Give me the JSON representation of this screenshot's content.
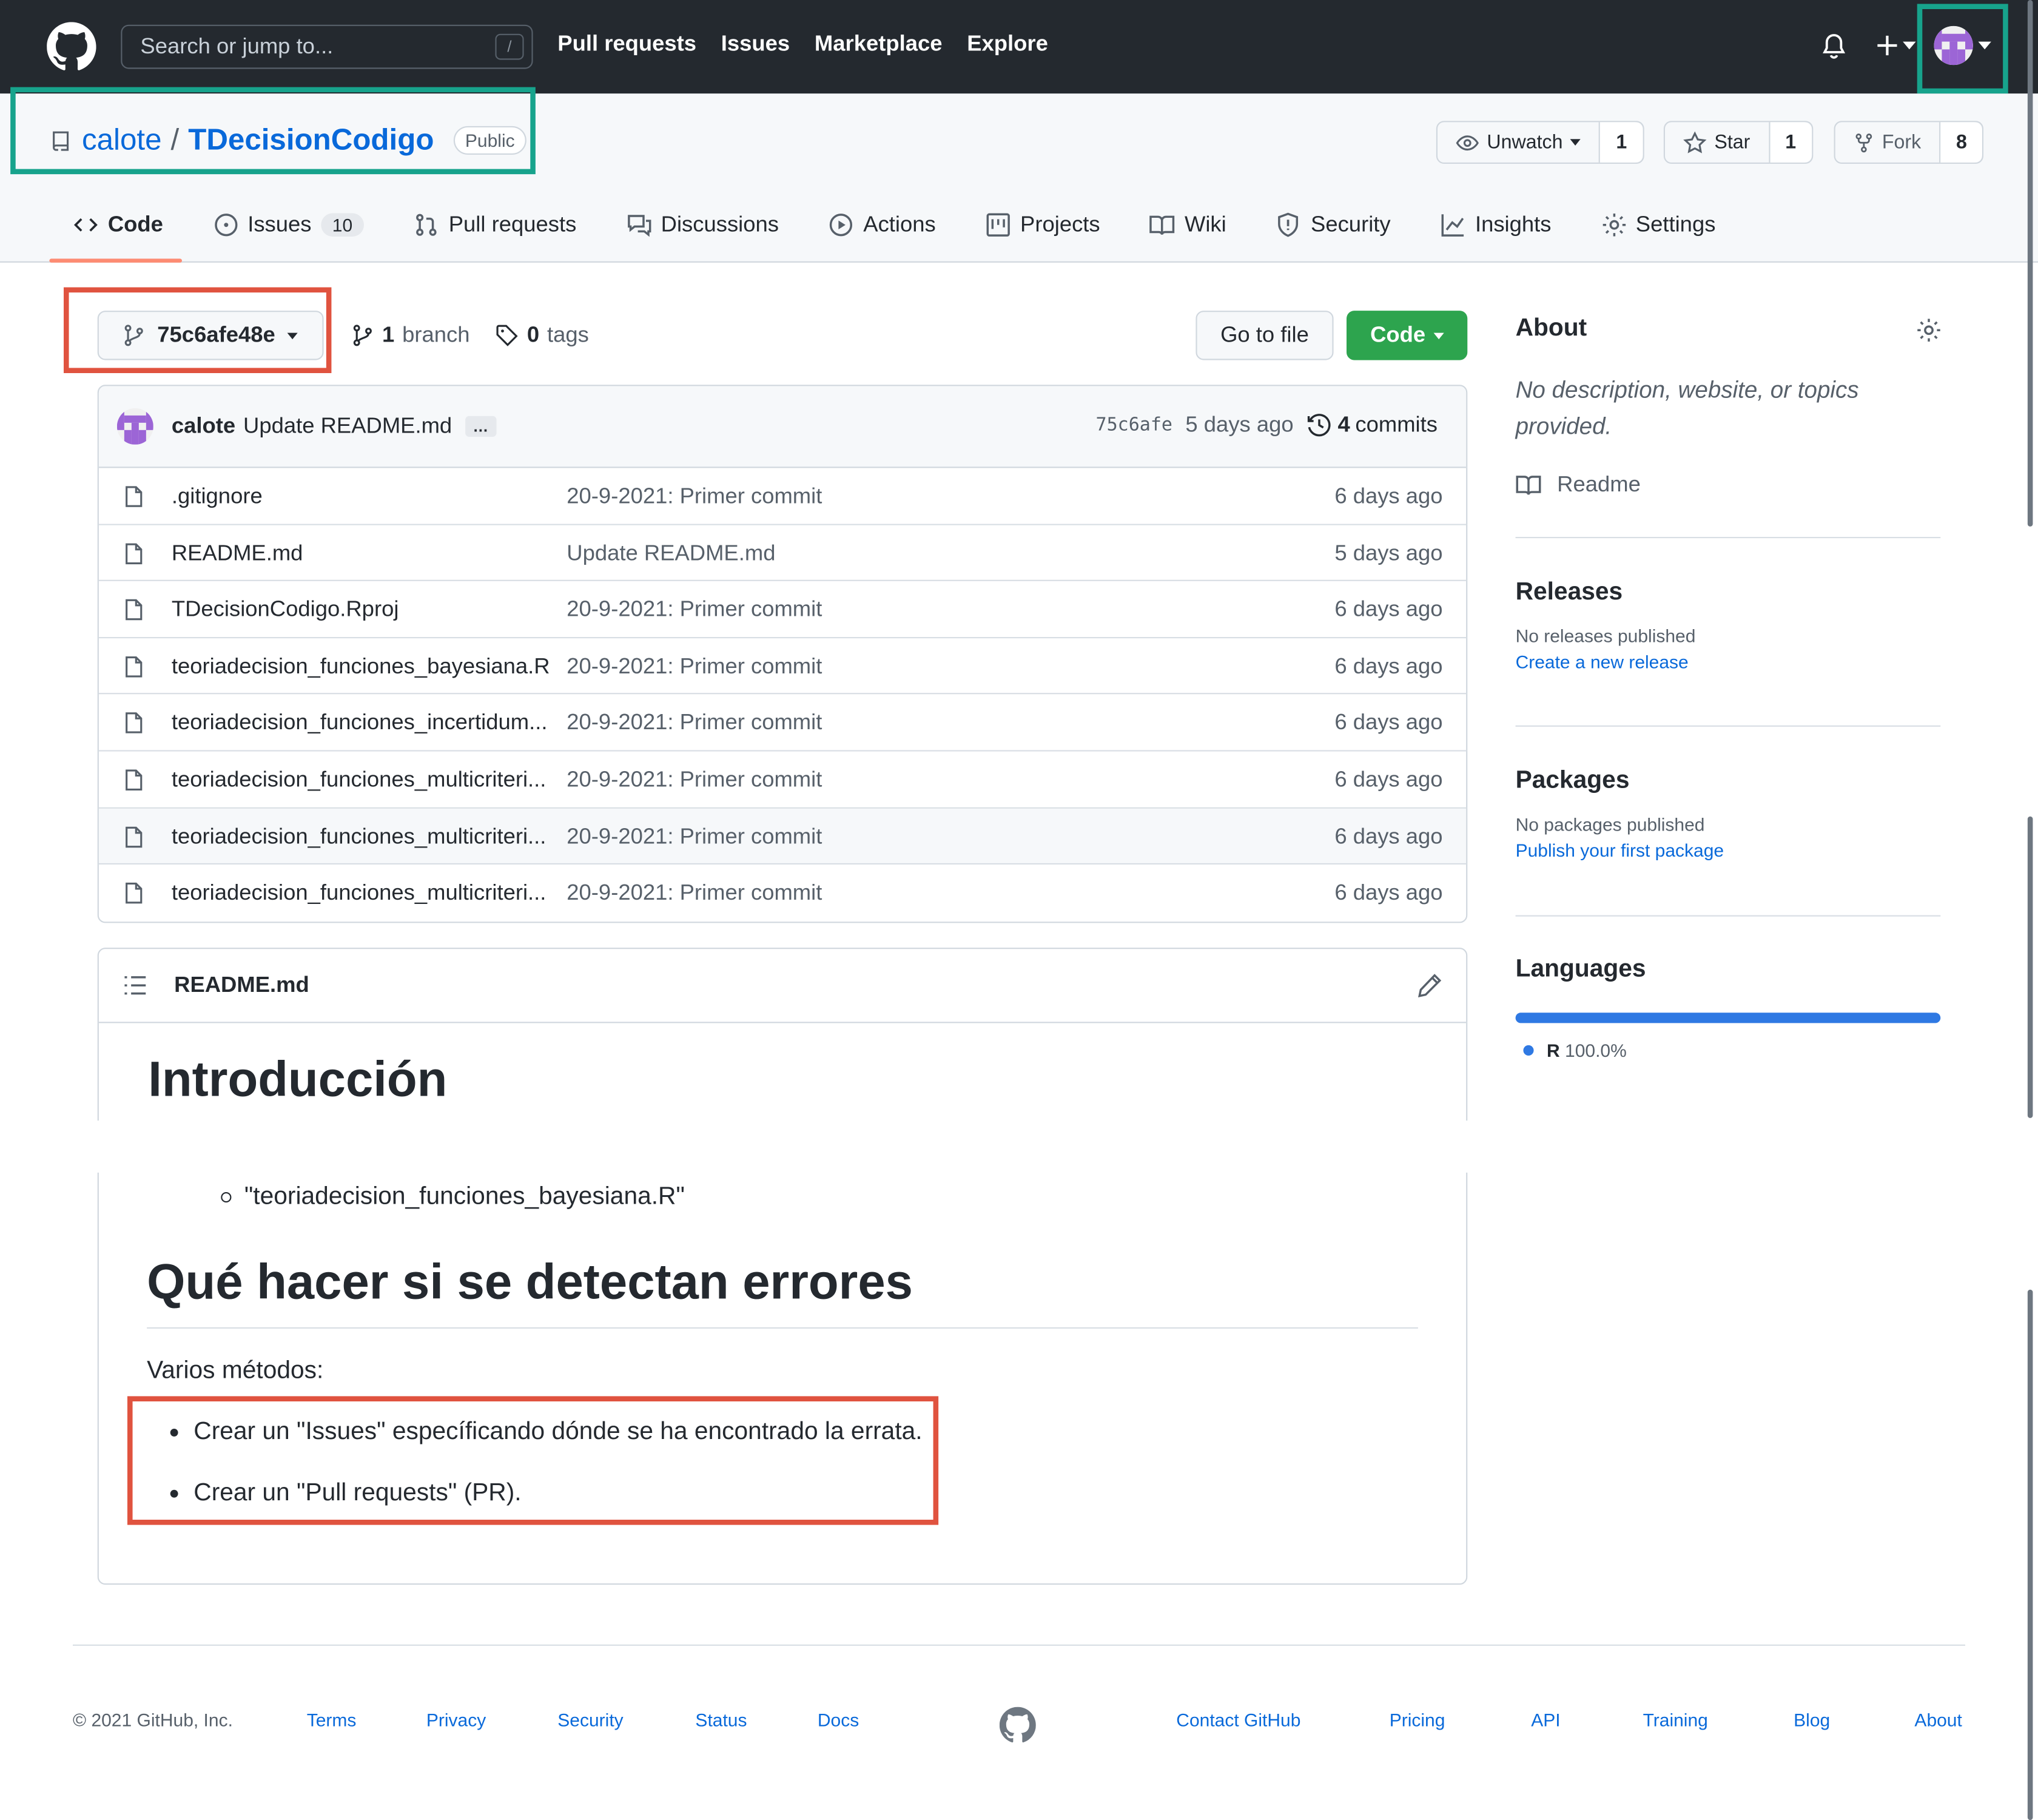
{
  "header": {
    "search_placeholder": "Search or jump to...",
    "search_shortcut": "/",
    "nav": [
      "Pull requests",
      "Issues",
      "Marketplace",
      "Explore"
    ]
  },
  "repo": {
    "owner": "calote",
    "separator": "/",
    "name": "TDecisionCodigo",
    "visibility": "Public",
    "watch_label": "Unwatch",
    "watch_count": "1",
    "star_label": "Star",
    "star_count": "1",
    "fork_label": "Fork",
    "fork_count": "8"
  },
  "tabs": [
    {
      "label": "Code",
      "icon": "code-icon"
    },
    {
      "label": "Issues",
      "count": "10",
      "icon": "issue-icon"
    },
    {
      "label": "Pull requests",
      "icon": "pull-request-icon"
    },
    {
      "label": "Discussions",
      "icon": "discussion-icon"
    },
    {
      "label": "Actions",
      "icon": "play-icon"
    },
    {
      "label": "Projects",
      "icon": "project-icon"
    },
    {
      "label": "Wiki",
      "icon": "book-icon"
    },
    {
      "label": "Security",
      "icon": "shield-icon"
    },
    {
      "label": "Insights",
      "icon": "graph-icon"
    },
    {
      "label": "Settings",
      "icon": "gear-icon"
    }
  ],
  "branch_bar": {
    "ref": "75c6afe48e",
    "branch_count": "1",
    "branch_label": "branch",
    "tag_count": "0",
    "tag_label": "tags",
    "go_to_file": "Go to file",
    "code_button": "Code"
  },
  "latest_commit": {
    "author": "calote",
    "message": "Update README.md",
    "ellipsis": "…",
    "sha": "75c6afe",
    "age": "5 days ago",
    "commit_count": "4",
    "commit_label": "commits"
  },
  "files": [
    {
      "name": ".gitignore",
      "message": "20-9-2021: Primer commit",
      "age": "6 days ago"
    },
    {
      "name": "README.md",
      "message": "Update README.md",
      "age": "5 days ago"
    },
    {
      "name": "TDecisionCodigo.Rproj",
      "message": "20-9-2021: Primer commit",
      "age": "6 days ago"
    },
    {
      "name": "teoriadecision_funciones_bayesiana.R",
      "message": "20-9-2021: Primer commit",
      "age": "6 days ago"
    },
    {
      "name": "teoriadecision_funciones_incertidum...",
      "message": "20-9-2021: Primer commit",
      "age": "6 days ago"
    },
    {
      "name": "teoriadecision_funciones_multicriteri...",
      "message": "20-9-2021: Primer commit",
      "age": "6 days ago"
    },
    {
      "name": "teoriadecision_funciones_multicriteri...",
      "message": "20-9-2021: Primer commit",
      "age": "6 days ago"
    },
    {
      "name": "teoriadecision_funciones_multicriteri...",
      "message": "20-9-2021: Primer commit",
      "age": "6 days ago"
    }
  ],
  "readme": {
    "filename": "README.md",
    "heading_intro": "Introducción",
    "sub_bullet": "\"teoriadecision_funciones_bayesiana.R\"",
    "heading_errors": "Qué hacer si se detectan errores",
    "varios": "Varios métodos:",
    "bullets": [
      "Crear un \"Issues\" específicando dónde se ha encontrado la errata.",
      "Crear un \"Pull requests\" (PR)."
    ]
  },
  "sidebar": {
    "about_title": "About",
    "about_desc": "No description, website, or topics provided.",
    "readme_link": "Readme",
    "releases_title": "Releases",
    "releases_none": "No releases published",
    "releases_link": "Create a new release",
    "packages_title": "Packages",
    "packages_none": "No packages published",
    "packages_link": "Publish your first package",
    "languages_title": "Languages",
    "language_name": "R",
    "language_pct": "100.0%",
    "language_fraction": 1.0,
    "language_color": "#2f79e3"
  },
  "footer": {
    "copyright": "© 2021 GitHub, Inc.",
    "left_links": [
      "Terms",
      "Privacy",
      "Security",
      "Status",
      "Docs"
    ],
    "right_links": [
      "Contact GitHub",
      "Pricing",
      "API",
      "Training",
      "Blog",
      "About"
    ]
  },
  "colors": {
    "header_bg": "#24292f",
    "link": "#0969da",
    "code_button": "#2da44e",
    "highlight_teal": "#17a38c",
    "highlight_red": "#e0533f"
  }
}
